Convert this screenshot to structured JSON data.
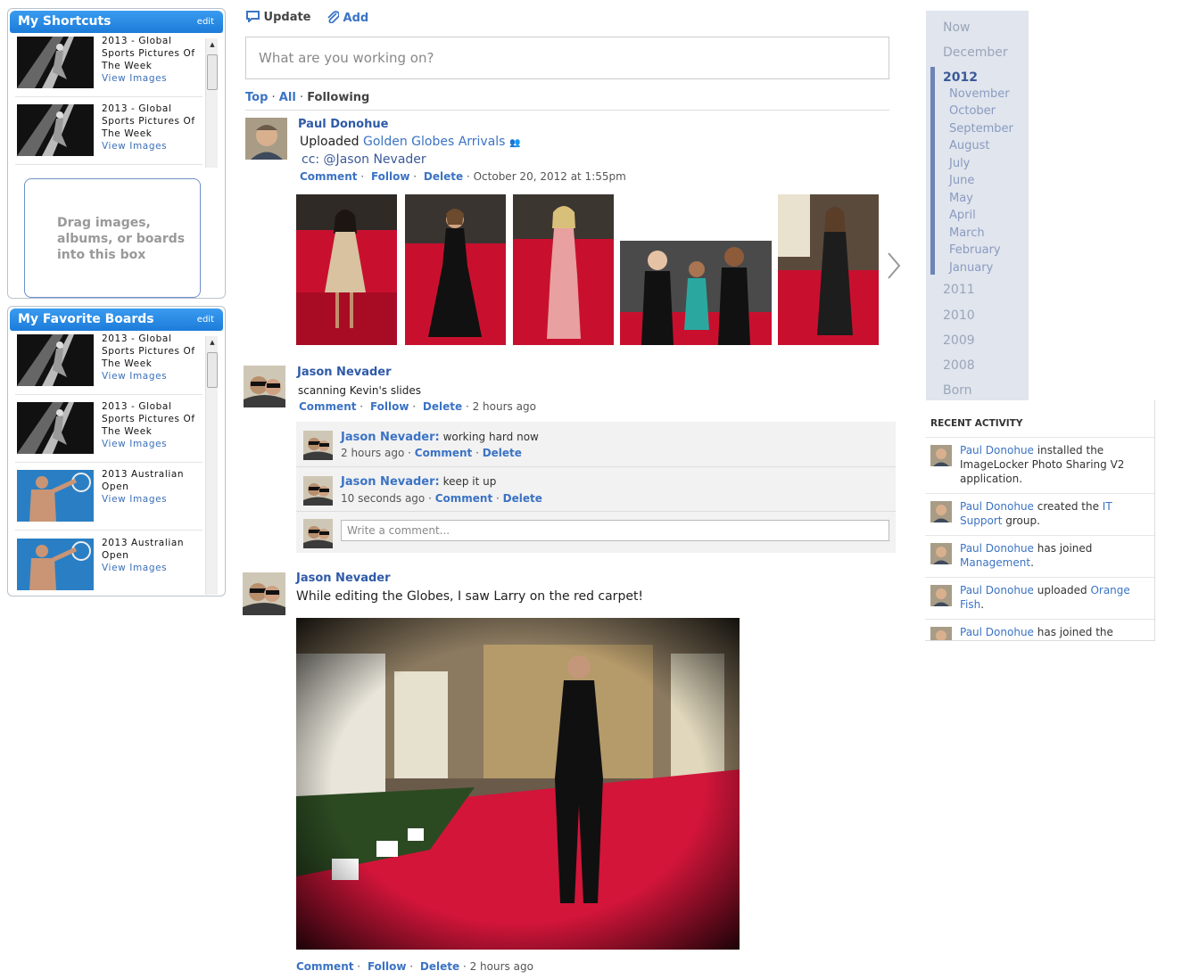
{
  "shortcuts": {
    "title": "My Shortcuts",
    "edit": "edit",
    "items": [
      {
        "title": "2013 - Global Sports Pictures Of The Week",
        "link": "View Images"
      },
      {
        "title": "2013 - Global Sports Pictures Of The Week",
        "link": "View Images"
      }
    ],
    "drop_text": "Drag images, albums, or boards into this box"
  },
  "favorites": {
    "title": "My Favorite Boards",
    "edit": "edit",
    "items": [
      {
        "title": "2013 - Global Sports Pictures Of The Week",
        "link": "View Images"
      },
      {
        "title": "2013 - Global Sports Pictures Of The Week",
        "link": "View Images"
      },
      {
        "title": "2013 Australian Open",
        "link": "View Images"
      },
      {
        "title": "2013 Australian Open",
        "link": "View Images"
      }
    ]
  },
  "composer": {
    "update": "Update",
    "add": "Add",
    "placeholder": "What are you working on?"
  },
  "filters": {
    "top": "Top",
    "sep1": " · ",
    "all": "All",
    "sep2": " · ",
    "following": "Following"
  },
  "posts": {
    "p1": {
      "author": "Paul Donohue",
      "uploaded": "Uploaded ",
      "album": "Golden Globes Arrivals",
      "cc": "cc: @Jason Nevader",
      "comment": "Comment",
      "follow": "Follow",
      "delete": "Delete",
      "time": "· October 20, 2012 at 1:55pm"
    },
    "p2": {
      "author": "Jason Nevader",
      "text": "scanning Kevin's slides",
      "comment": "Comment",
      "follow": "Follow",
      "delete": "Delete",
      "time": "· 2 hours ago",
      "replies": [
        {
          "author": "Jason Nevader:",
          "text": " working hard now",
          "time": "2 hours ago · ",
          "comment": "Comment",
          "delete": "Delete"
        },
        {
          "author": "Jason Nevader:",
          "text": " keep it up",
          "time": "10 seconds ago · ",
          "comment": "Comment",
          "delete": "Delete"
        }
      ],
      "write_placeholder": "Write a comment..."
    },
    "p3": {
      "author": "Jason Nevader",
      "text": "While editing the Globes, I saw Larry on the red carpet!",
      "comment": "Comment",
      "follow": "Follow",
      "delete": "Delete",
      "time": "· 2 hours ago"
    }
  },
  "timeline": {
    "now": "Now",
    "december": "December",
    "y2012": "2012",
    "months": [
      "November",
      "October",
      "September",
      "August",
      "July",
      "June",
      "May",
      "April",
      "March",
      "February",
      "January"
    ],
    "years": [
      "2011",
      "2010",
      "2009",
      "2008"
    ],
    "born": "Born"
  },
  "recent": {
    "heading": "RECENT ACTIVITY",
    "items": [
      {
        "user": "Paul Donohue",
        "text": " installed the ImageLocker Photo Sharing V2 application.",
        "link": ""
      },
      {
        "user": "Paul Donohue",
        "text": " created the ",
        "link": "IT Support",
        "tail": " group."
      },
      {
        "user": "Paul Donohue",
        "text": " has joined ",
        "link": "Management",
        "tail": "."
      },
      {
        "user": "Paul Donohue",
        "text": " uploaded ",
        "link": "Orange Fish",
        "tail": "."
      },
      {
        "user": "Paul Donohue",
        "text": " has joined the",
        "link": ""
      }
    ]
  },
  "colors": {
    "header_blue": "#1c7cd9",
    "link": "#3b73c4",
    "name": "#2f5aa8",
    "carpet": "#c8102e"
  }
}
